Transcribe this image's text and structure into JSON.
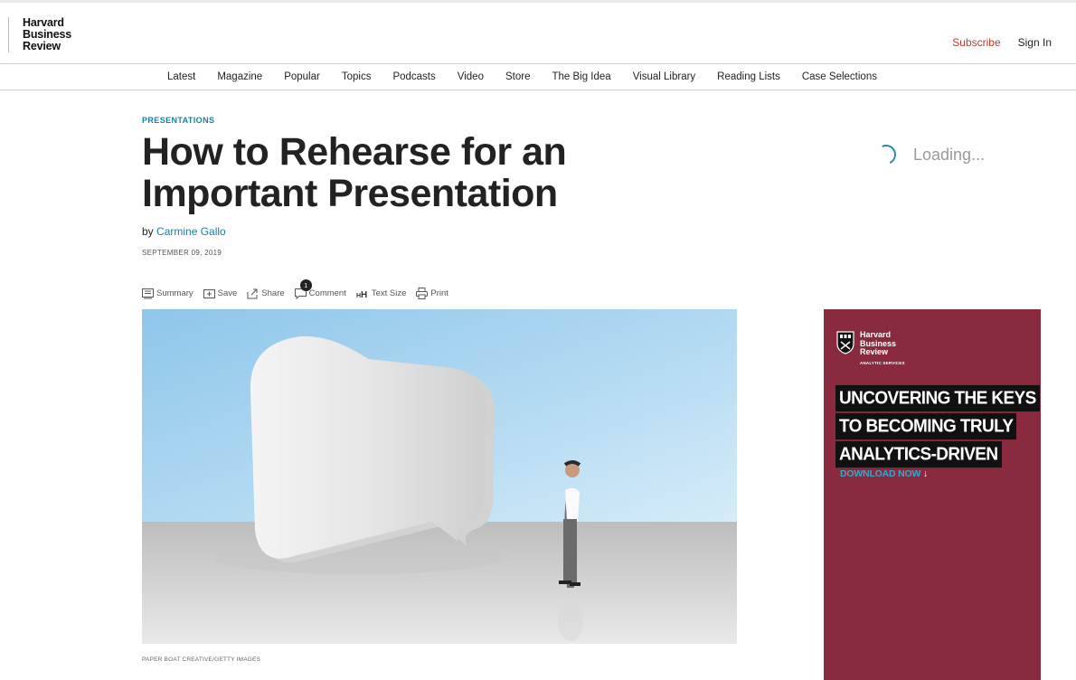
{
  "header": {
    "logo": [
      "Harvard",
      "Business",
      "Review"
    ],
    "subscribe": "Subscribe",
    "sign_in": "Sign In"
  },
  "nav": {
    "items": [
      "Latest",
      "Magazine",
      "Popular",
      "Topics",
      "Podcasts",
      "Video",
      "Store",
      "The Big Idea",
      "Visual Library",
      "Reading Lists",
      "Case Selections"
    ]
  },
  "article": {
    "kicker": "PRESENTATIONS",
    "title": "How to Rehearse for an Important Presentation",
    "by": "by",
    "author": "Carmine Gallo",
    "date": "SEPTEMBER 09, 2019",
    "image_credit": "PAPER BOAT CREATIVE/GETTY IMAGES"
  },
  "tools": {
    "summary": "Summary",
    "save": "Save",
    "share": "Share",
    "comment": "Comment",
    "comment_count": "1",
    "text_size": "Text Size",
    "print": "Print"
  },
  "loading": {
    "text": "Loading..."
  },
  "ad": {
    "brand": [
      "Harvard",
      "Business",
      "Review"
    ],
    "brand_sub": "ANALYTIC SERVICES",
    "headline": [
      "UNCOVERING THE KEYS",
      "TO BECOMING TRULY",
      "ANALYTICS-DRIVEN"
    ],
    "cta": "DOWNLOAD NOW",
    "background": "#8a2a3f",
    "cta_color": "#3aa6c9"
  },
  "colors": {
    "accent": "#1a7fa3",
    "subscribe": "#c0392b"
  }
}
